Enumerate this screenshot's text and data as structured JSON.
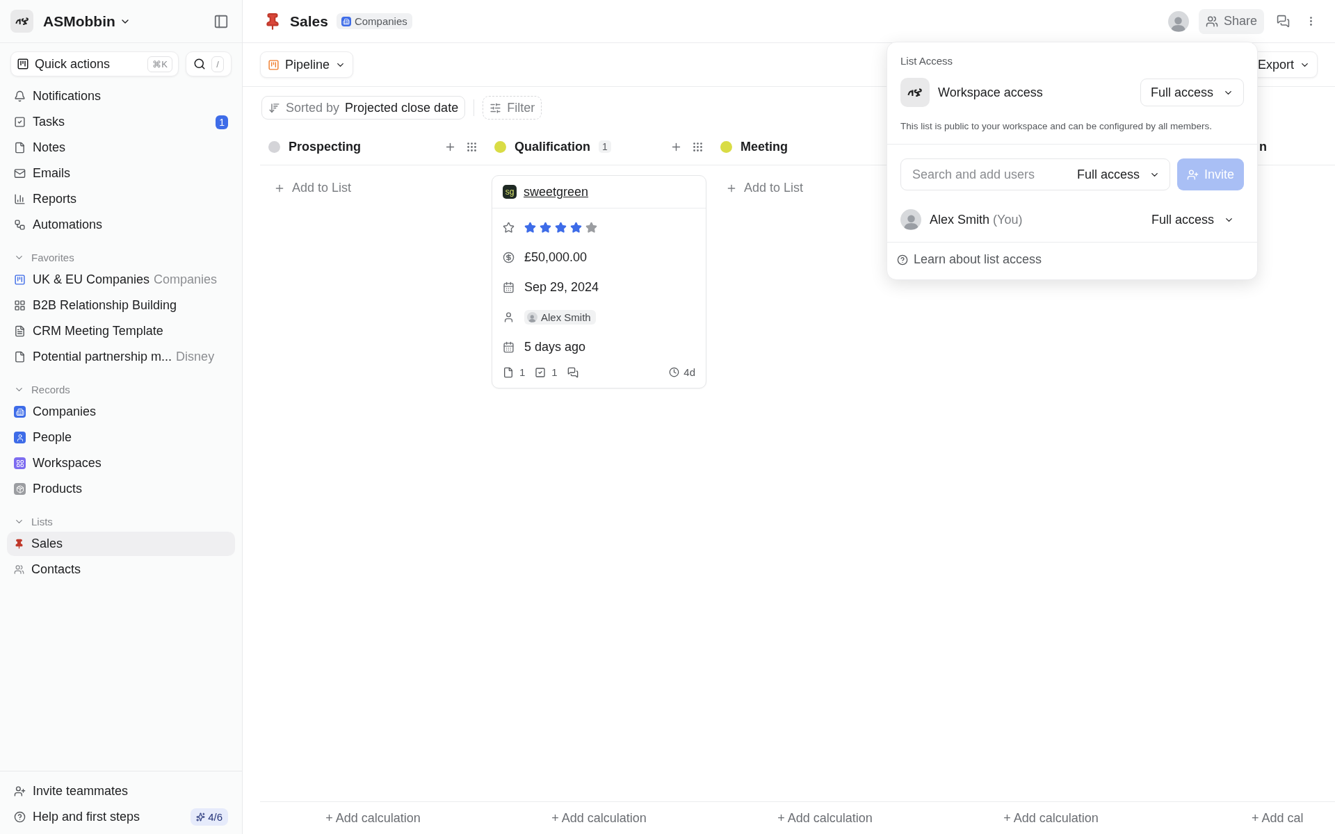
{
  "sidebar": {
    "workspace": "ASMobbin",
    "quick_actions": {
      "label": "Quick actions",
      "shortcut": "⌘K"
    },
    "search_shortcut": "/",
    "nav": [
      {
        "label": "Notifications"
      },
      {
        "label": "Tasks",
        "badge": "1"
      },
      {
        "label": "Notes"
      },
      {
        "label": "Emails"
      },
      {
        "label": "Reports"
      },
      {
        "label": "Automations"
      }
    ],
    "sections": [
      {
        "title": "Favorites",
        "expanded": true,
        "items": [
          {
            "label": "UK & EU Companies",
            "secondary": "Companies",
            "selected": false
          },
          {
            "label": "B2B Relationship Building",
            "selected": false
          },
          {
            "label": "CRM Meeting Template",
            "selected": false
          },
          {
            "label": "Potential partnership m...",
            "secondary": "Disney",
            "selected": false
          }
        ]
      },
      {
        "title": "Records",
        "expanded": true,
        "items": [
          {
            "label": "Companies",
            "selected": false
          },
          {
            "label": "People",
            "selected": false
          },
          {
            "label": "Workspaces",
            "selected": false
          },
          {
            "label": "Products",
            "selected": false
          }
        ]
      },
      {
        "title": "Lists",
        "expanded": true,
        "items": [
          {
            "label": "Sales",
            "selected": true
          },
          {
            "label": "Contacts",
            "selected": false
          }
        ]
      }
    ],
    "footer": [
      {
        "label": "Invite teammates"
      },
      {
        "label": "Help and first steps",
        "badge": "4/6"
      }
    ]
  },
  "header": {
    "title": "Sales",
    "tag": "Companies",
    "share": "Share"
  },
  "toolbar": {
    "view": "Pipeline",
    "export": "Export"
  },
  "filters": {
    "sort_prefix": "Sorted by",
    "sort_value": "Projected close date",
    "filter": "Filter"
  },
  "board": {
    "columns": [
      {
        "title": "Prospecting",
        "color": "#d4d4d8",
        "add_label": "Add to List"
      },
      {
        "title": "Qualification",
        "color": "#d9dc45",
        "count": "1",
        "cards": [
          {
            "company": "sweetgreen",
            "logo": "sg",
            "stars": 4,
            "amount": "£50,000.00",
            "date": "Sep 29, 2024",
            "owner": "Alex Smith",
            "last_contact": "5 days ago",
            "notes": "1",
            "tasks": "1",
            "age": "4d"
          }
        ]
      },
      {
        "title": "Meeting",
        "color": "#d9dc45",
        "add_label": "Add to List"
      }
    ],
    "cut_heading": "n",
    "calculations": [
      "+ Add calculation",
      "+ Add calculation",
      "+ Add calculation",
      "+ Add calculation",
      "+ Add cal"
    ]
  },
  "popover": {
    "title": "List Access",
    "workspace_access": {
      "label": "Workspace access",
      "level": "Full access"
    },
    "description": "This list is public to your workspace and can be configured by all members.",
    "search": {
      "placeholder": "Search and add users",
      "level": "Full access"
    },
    "invite": {
      "label": "Invite",
      "disabled": true
    },
    "members": [
      {
        "name": "Alex Smith",
        "suffix": "(You)",
        "level": "Full access"
      }
    ],
    "learn": "Learn about list access"
  }
}
